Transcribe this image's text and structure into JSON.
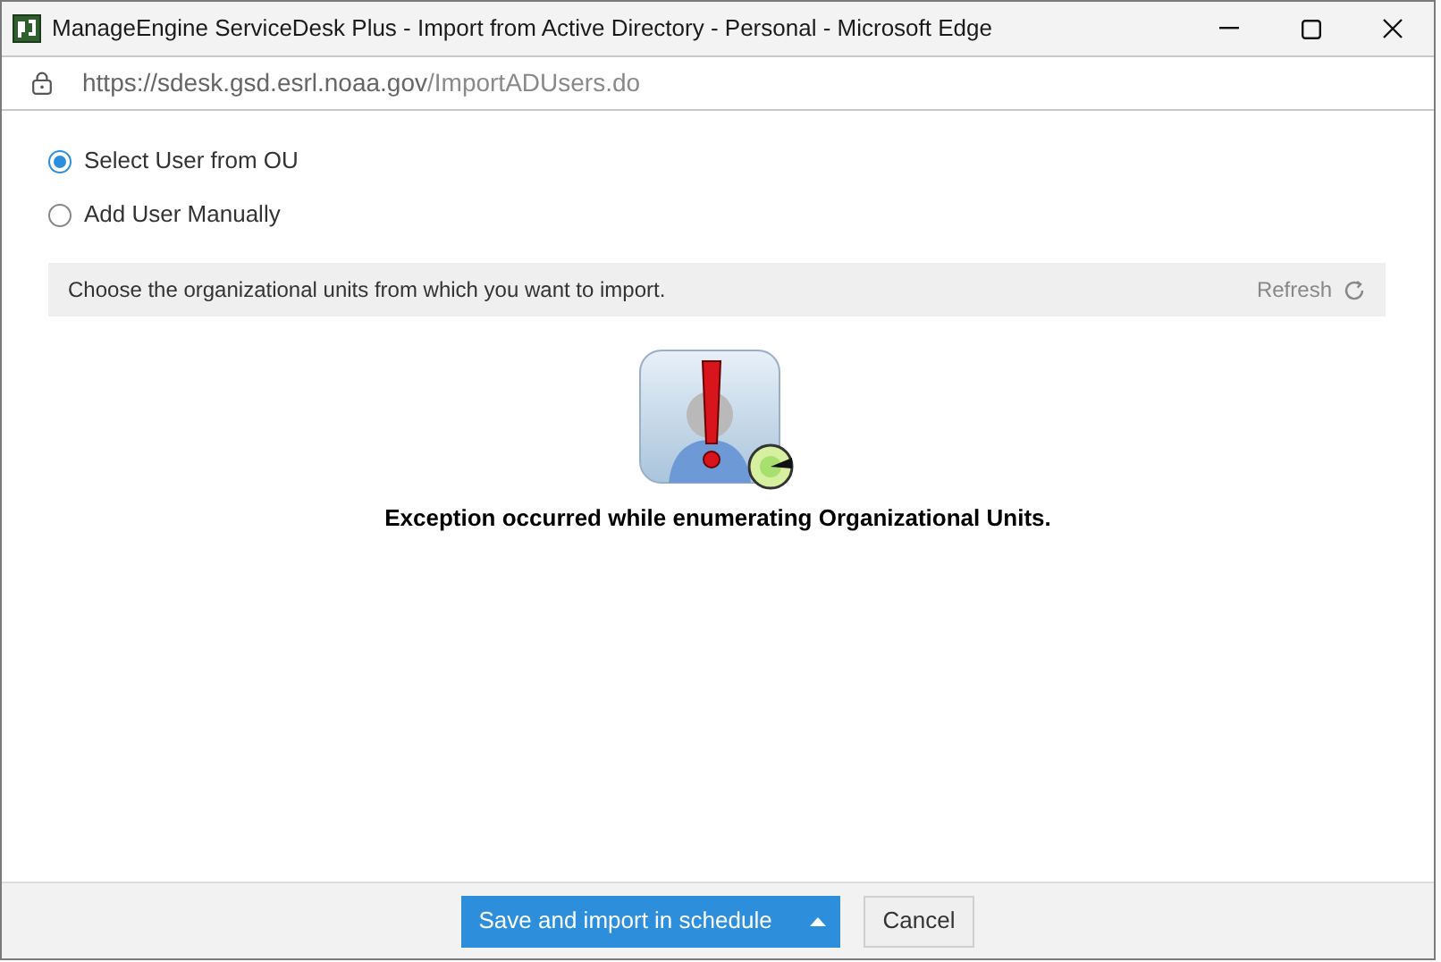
{
  "window": {
    "title": "ManageEngine ServiceDesk Plus - Import from Active Directory - Personal - Microsoft Edge"
  },
  "address_bar": {
    "url_host": "https://sdesk.gsd.esrl.noaa.gov",
    "url_path": "/ImportADUsers.do"
  },
  "options": [
    {
      "label": "Select User from OU",
      "selected": true
    },
    {
      "label": "Add User Manually",
      "selected": false
    }
  ],
  "info_bar": {
    "text": "Choose the organizational units from which you want to import.",
    "action": "Refresh"
  },
  "message": "Exception occurred while enumerating Organizational Units.",
  "footer": {
    "primary_button": "Save and import in schedule",
    "cancel_button": "Cancel"
  }
}
